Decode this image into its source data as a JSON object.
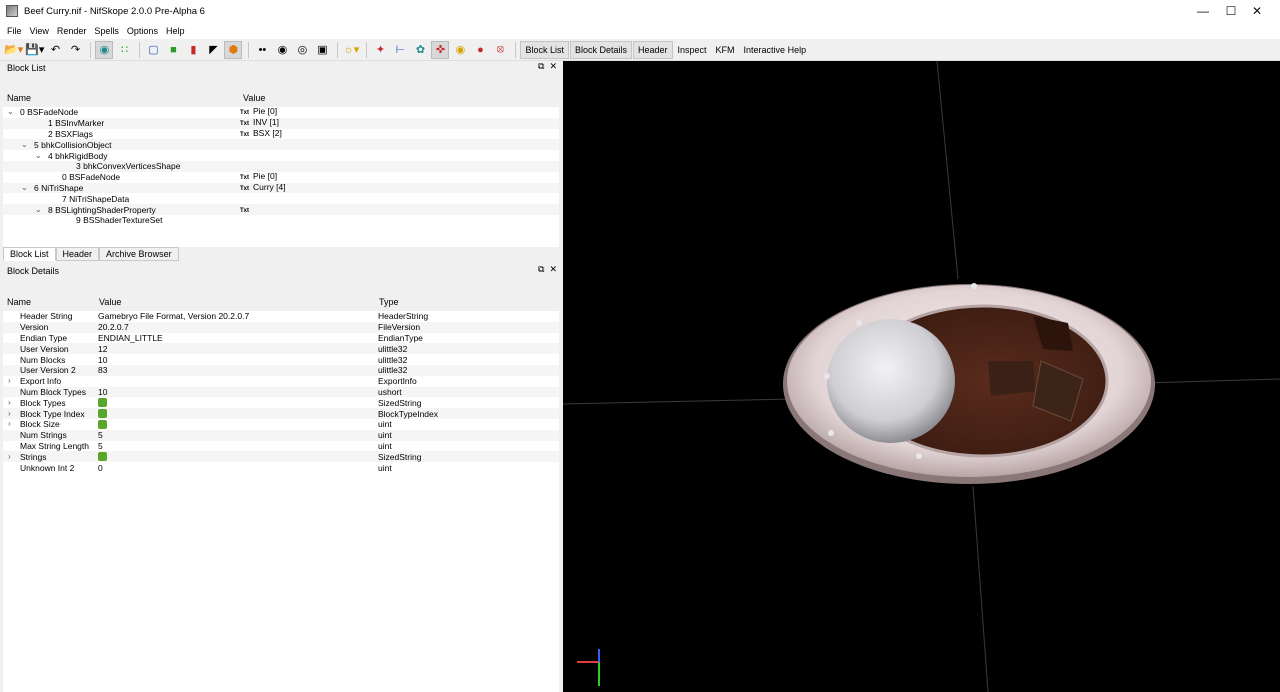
{
  "window": {
    "title": "Beef Curry.nif - NifSkope 2.0.0 Pre-Alpha 6",
    "controls": [
      "—",
      "☐",
      "✕"
    ]
  },
  "menu": [
    "File",
    "View",
    "Render",
    "Spells",
    "Options",
    "Help"
  ],
  "toolbar": {
    "tabs": [
      "Block List",
      "Block Details",
      "Header",
      "Inspect",
      "KFM",
      "Interactive Help"
    ]
  },
  "block_list": {
    "title": "Block List",
    "col_name": "Name",
    "col_value": "Value",
    "rows": [
      {
        "name": "0 BSFadeNode",
        "value": "Pie [0]",
        "txt": "Txt",
        "indent": 0,
        "arrow": "⌄"
      },
      {
        "name": "1 BSInvMarker",
        "value": "INV [1]",
        "txt": "Txt",
        "indent": 2,
        "arrow": ""
      },
      {
        "name": "2 BSXFlags",
        "value": "BSX [2]",
        "txt": "Txt",
        "indent": 2,
        "arrow": ""
      },
      {
        "name": "5 bhkCollisionObject",
        "value": "",
        "txt": "",
        "indent": 1,
        "arrow": "⌄"
      },
      {
        "name": "4 bhkRigidBody",
        "value": "",
        "txt": "",
        "indent": 2,
        "arrow": "⌄"
      },
      {
        "name": "3 bhkConvexVerticesShape",
        "value": "",
        "txt": "",
        "indent": 4,
        "arrow": ""
      },
      {
        "name": "0 BSFadeNode",
        "value": "Pie [0]",
        "txt": "Txt",
        "indent": 3,
        "arrow": ""
      },
      {
        "name": "6 NiTriShape",
        "value": "Curry [4]",
        "txt": "Txt",
        "indent": 1,
        "arrow": "⌄"
      },
      {
        "name": "7 NiTriShapeData",
        "value": "",
        "txt": "",
        "indent": 3,
        "arrow": ""
      },
      {
        "name": "8 BSLightingShaderProperty",
        "value": "",
        "txt": "Txt",
        "indent": 2,
        "arrow": "⌄"
      },
      {
        "name": "9 BSShaderTextureSet",
        "value": "",
        "txt": "",
        "indent": 4,
        "arrow": ""
      }
    ]
  },
  "bottom_tabs": [
    "Block List",
    "Header",
    "Archive Browser"
  ],
  "block_details": {
    "title": "Block Details",
    "col_name": "Name",
    "col_value": "Value",
    "col_type": "Type",
    "rows": [
      {
        "name": "Header String",
        "value": "Gamebryo File Format, Version 20.2.0.7",
        "type": "HeaderString",
        "expand": false,
        "icon": false
      },
      {
        "name": "Version",
        "value": "20.2.0.7",
        "type": "FileVersion",
        "expand": false,
        "icon": false
      },
      {
        "name": "Endian Type",
        "value": "ENDIAN_LITTLE",
        "type": "EndianType",
        "expand": false,
        "icon": false
      },
      {
        "name": "User Version",
        "value": "12",
        "type": "ulittle32",
        "expand": false,
        "icon": false
      },
      {
        "name": "Num Blocks",
        "value": "10",
        "type": "ulittle32",
        "expand": false,
        "icon": false
      },
      {
        "name": "User Version 2",
        "value": "83",
        "type": "ulittle32",
        "expand": false,
        "icon": false
      },
      {
        "name": "Export Info",
        "value": "",
        "type": "ExportInfo",
        "expand": true,
        "icon": false
      },
      {
        "name": "Num Block Types",
        "value": "10",
        "type": "ushort",
        "expand": false,
        "icon": false
      },
      {
        "name": "Block Types",
        "value": "",
        "type": "SizedString",
        "expand": true,
        "icon": true
      },
      {
        "name": "Block Type Index",
        "value": "",
        "type": "BlockTypeIndex",
        "expand": true,
        "icon": true
      },
      {
        "name": "Block Size",
        "value": "",
        "type": "uint",
        "expand": true,
        "icon": true
      },
      {
        "name": "Num Strings",
        "value": "5",
        "type": "uint",
        "expand": false,
        "icon": false
      },
      {
        "name": "Max String Length",
        "value": "5",
        "type": "uint",
        "expand": false,
        "icon": false
      },
      {
        "name": "Strings",
        "value": "",
        "type": "SizedString",
        "expand": true,
        "icon": true
      },
      {
        "name": "Unknown Int 2",
        "value": "0",
        "type": "uint",
        "expand": false,
        "icon": false
      }
    ]
  },
  "colors": {
    "viewport_bg": "#000000",
    "grid": "#3a3a3a",
    "plate": "#e9dddd",
    "curry": "#4a2418",
    "rice": "#d9d9dc"
  }
}
